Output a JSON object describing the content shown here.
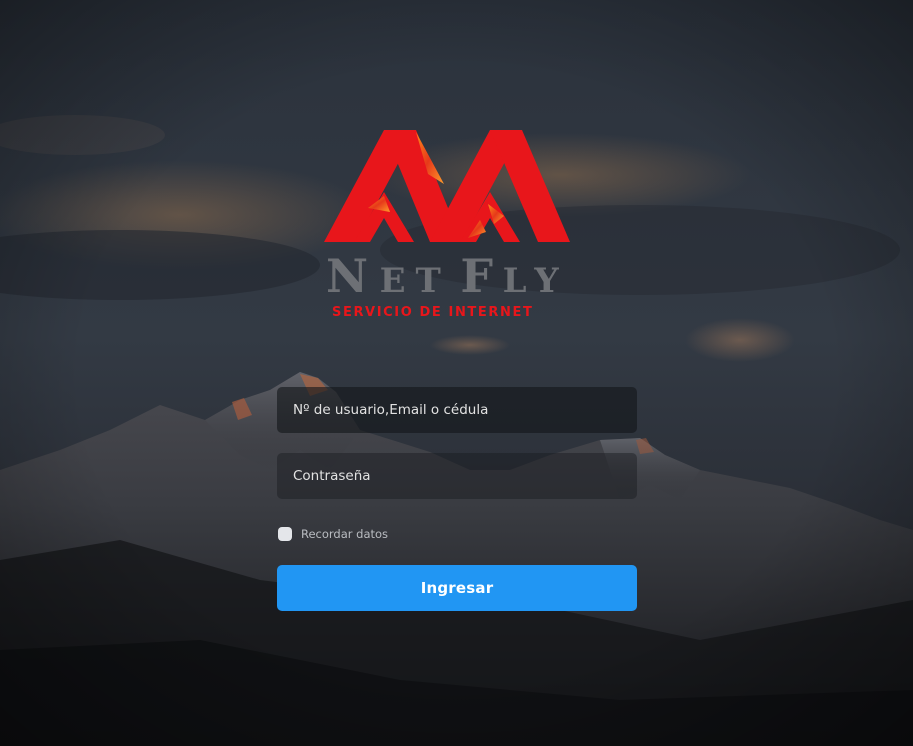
{
  "brand": {
    "logo_word_first": "N",
    "logo_word_rest_1": "ET",
    "logo_word_second": "F",
    "logo_word_rest_2": "LY",
    "tagline": "SERVICIO DE INTERNET",
    "primary_color": "#e8161b",
    "secondary_color": "#6d7075"
  },
  "login": {
    "username_placeholder": "Nº de usuario,Email o cédula",
    "password_placeholder": "Contraseña",
    "remember_label": "Recordar datos",
    "remember_checked": false,
    "submit_label": "Ingresar",
    "submit_color": "#2196f3"
  }
}
